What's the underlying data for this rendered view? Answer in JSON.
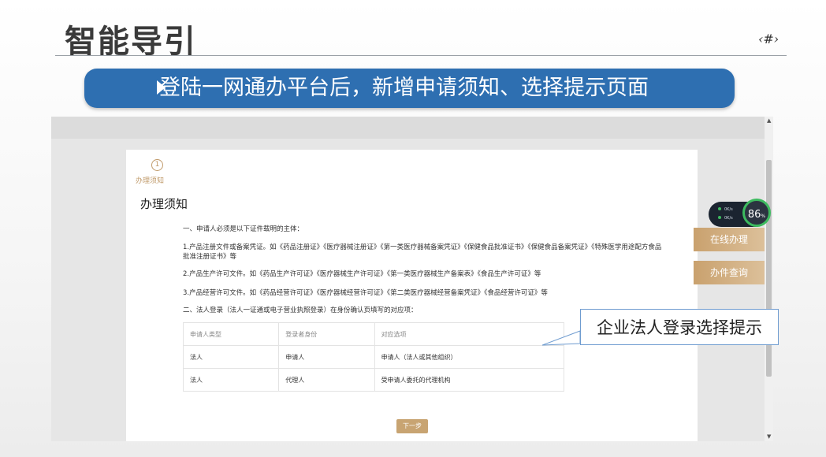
{
  "slide": {
    "title": "智能导引",
    "page_number": "‹#›",
    "banner_text": "登陆一网通办平台后，新增申请须知、选择提示页面"
  },
  "app": {
    "step": {
      "number": "1",
      "label": "办理须知"
    },
    "heading": "办理须知",
    "paragraphs": [
      "一、申请人必须是以下证件载明的主体：",
      "1.产品注册文件或备案凭证。如《药品注册证》《医疗器械注册证》《第一类医疗器械备案凭证》《保健食品批准证书》《保健食品备案凭证》《特殊医学用途配方食品批准注册证书》等",
      "2.产品生产许可文件。如《药品生产许可证》《医疗器械生产许可证》《第一类医疗器械生产备案表》《食品生产许可证》等",
      "3.产品经营许可文件。如《药品经营许可证》《医疗器械经营许可证》《第二类医疗器械经营备案凭证》《食品经营许可证》等",
      "二、法人登录（法人一证通或电子营业执照登录）在身份确认页填写的对应项："
    ],
    "table": {
      "headers": [
        "申请人类型",
        "登录者身份",
        "对应选项"
      ],
      "rows": [
        [
          "法人",
          "申请人",
          "申请人（法人或其他组织）"
        ],
        [
          "法人",
          "代理人",
          "受申请人委托的代理机构"
        ]
      ]
    },
    "next_button": "下一步",
    "side_buttons": [
      "在线办理",
      "办件查询"
    ],
    "speed_widget": {
      "percent": "86",
      "unit": "%",
      "up": "0K/s",
      "down": "0K/s"
    }
  },
  "callout": "企业法人登录选择提示",
  "colors": {
    "banner": "#2e6fb1",
    "accent_gold": "#c8a472",
    "callout_border": "#6f9cd0"
  }
}
